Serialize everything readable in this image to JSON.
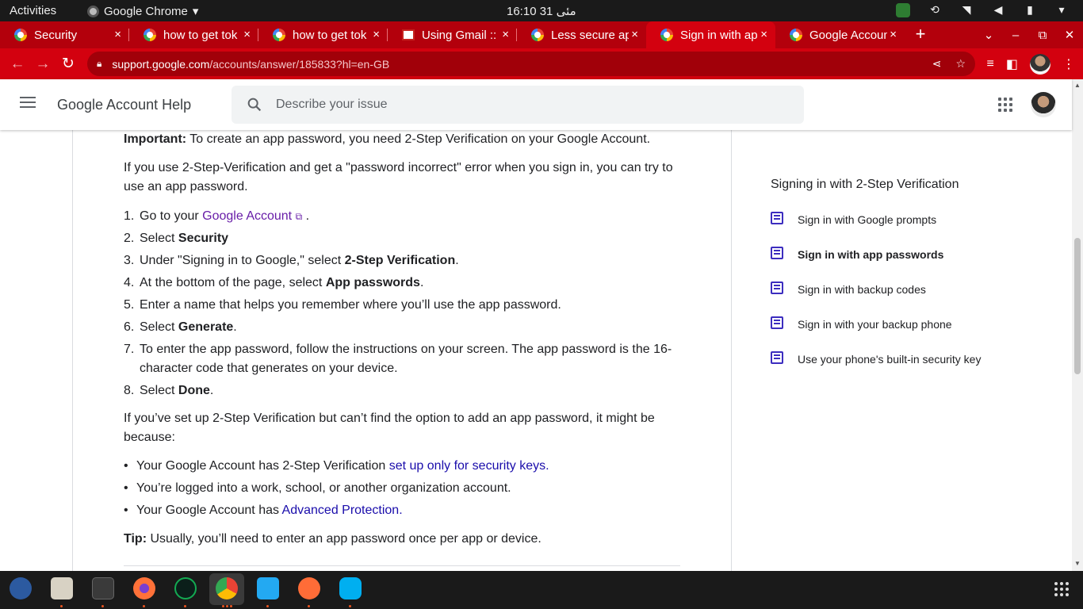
{
  "system": {
    "activities": "Activities",
    "app_name": "Google Chrome",
    "app_menu_caret": "▾",
    "clock": "16:10  31 مئی"
  },
  "tabs": [
    {
      "label": "Security",
      "icon": "google-icon",
      "active": false
    },
    {
      "label": "how to get tok",
      "icon": "google-icon",
      "active": false
    },
    {
      "label": "how to get tok",
      "icon": "google-icon",
      "active": false
    },
    {
      "label": "Using Gmail ::",
      "icon": "gmail-icon",
      "active": false
    },
    {
      "label": "Less secure ap",
      "icon": "google-icon",
      "active": false
    },
    {
      "label": "Sign in with ap",
      "icon": "google-icon",
      "active": true
    },
    {
      "label": "Google Accoun",
      "icon": "google-icon",
      "active": false
    }
  ],
  "tab_close": "×",
  "new_tab": "+",
  "window_controls": {
    "tablist": "⌄",
    "minimize": "–",
    "restore": "⧉",
    "close": "✕"
  },
  "omnibox": {
    "host": "support.google.com",
    "path": "/accounts/answer/185833?hl=en-GB"
  },
  "header": {
    "title": "Google Account Help",
    "search_placeholder": "Describe your issue"
  },
  "article": {
    "important_label": "Important:",
    "important_text": " To create an app password, you need 2-Step Verification on your Google Account.",
    "intro": "If you use 2-Step-Verification and get a \"password incorrect\" error when you sign in, you can try to use an app password.",
    "steps": [
      {
        "n": "1.",
        "pre": "Go to your ",
        "link": "Google Account",
        "post": " ."
      },
      {
        "n": "2.",
        "pre": "Select ",
        "bold": "Security",
        "post": ""
      },
      {
        "n": "3.",
        "pre": "Under \"Signing in to Google,\" select ",
        "bold": "2-Step Verification",
        "post": "."
      },
      {
        "n": "4.",
        "pre": "At the bottom of the page, select ",
        "bold": "App passwords",
        "post": "."
      },
      {
        "n": "5.",
        "pre": "Enter a name that helps you remember where you’ll use the app password.",
        "bold": "",
        "post": ""
      },
      {
        "n": "6.",
        "pre": "Select ",
        "bold": "Generate",
        "post": "."
      },
      {
        "n": "7.",
        "pre": "To enter the app password, follow the instructions on your screen. The app password is the 16-character code that generates on your device.",
        "bold": "",
        "post": ""
      },
      {
        "n": "8.",
        "pre": "Select ",
        "bold": "Done",
        "post": "."
      }
    ],
    "cause_intro": "If you’ve set up 2-Step Verification but can’t find the option to add an app password, it might be because:",
    "causes": [
      {
        "pre": "Your Google Account has 2-Step Verification ",
        "link": "set up only for security keys",
        "post": "."
      },
      {
        "pre": "You’re logged into a work, school, or another organization account.",
        "link": "",
        "post": ""
      },
      {
        "pre": "Your Google Account has ",
        "link": "Advanced Protection",
        "post": "."
      }
    ],
    "tip_label": "Tip:",
    "tip_text": " Usually, you’ll need to enter an app password once per app or device."
  },
  "sidebar": {
    "title": "Signing in with 2-Step Verification",
    "items": [
      {
        "label": "Sign in with Google prompts",
        "current": false
      },
      {
        "label": "Sign in with app passwords",
        "current": true
      },
      {
        "label": "Sign in with backup codes",
        "current": false
      },
      {
        "label": "Sign in with your backup phone",
        "current": false
      },
      {
        "label": "Use your phone's built-in security key",
        "current": false
      }
    ]
  },
  "dock": [
    {
      "name": "eclipse-icon",
      "color": "#2c5aa0",
      "running": false
    },
    {
      "name": "files-icon",
      "color": "#d8d2c4",
      "running": true
    },
    {
      "name": "terminal-icon",
      "color": "#3a3a3a",
      "running": true
    },
    {
      "name": "firefox-icon",
      "color": "#ff7139",
      "running": true
    },
    {
      "name": "mongodb-compass-icon",
      "color": "#13aa52",
      "running": true
    },
    {
      "name": "chrome-icon",
      "color": "#4285f4",
      "running": true
    },
    {
      "name": "vscode-icon",
      "color": "#23a9f2",
      "running": true
    },
    {
      "name": "postman-icon",
      "color": "#ff6c37",
      "running": true
    },
    {
      "name": "skype-icon",
      "color": "#00aff0",
      "running": true
    }
  ],
  "colors": {
    "brand_red": "#d3010f",
    "link": "#1a0dab",
    "visited": "#681da8",
    "sidebar_icon": "#3c2dbf"
  }
}
